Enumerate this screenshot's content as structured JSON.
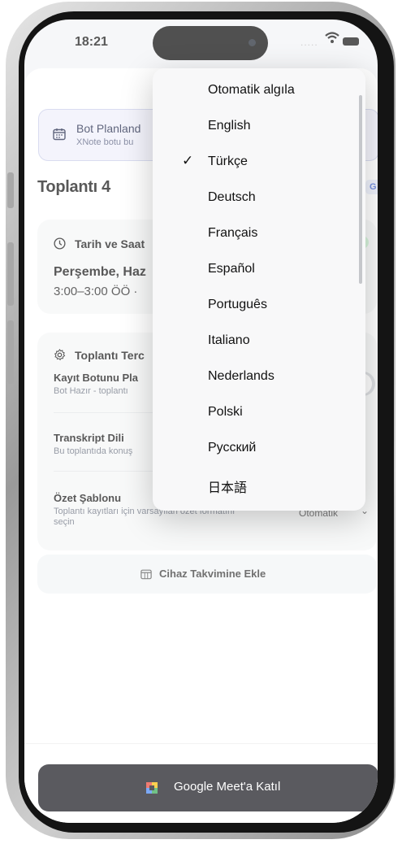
{
  "status_bar": {
    "time": "18:21"
  },
  "banner": {
    "title": "Bot Planland",
    "subtitle": "XNote botu bu"
  },
  "meeting": {
    "title": "Toplantı 4",
    "edit_icon_letter": "G"
  },
  "datetime_card": {
    "heading": "Tarih ve Saat",
    "date": "Perşembe, Haz",
    "time_range": "3:00–3:00 ÖÖ ·"
  },
  "preferences_card": {
    "heading": "Toplantı Terc",
    "bot_label": "Kayıt Botunu Pla",
    "bot_desc": "Bot Hazır - toplantı",
    "transcript_label": "Transkript Dili",
    "transcript_desc": "Bu toplantıda konuş",
    "summary_label": "Özet Şablonu",
    "summary_desc": "Toplantı kayıtları için varsayılan özet formatını seçin",
    "summary_value": "Otomatik"
  },
  "calendar_button": {
    "label": "Cihaz Takvimine Ekle"
  },
  "join_button": {
    "label": "Google Meet'a Katıl"
  },
  "language_menu": {
    "selected": "Türkçe",
    "items": [
      {
        "label": "Otomatik algıla",
        "check": ""
      },
      {
        "label": "English",
        "check": ""
      },
      {
        "label": "Türkçe",
        "check": "✓"
      },
      {
        "label": "Deutsch",
        "check": ""
      },
      {
        "label": "Français",
        "check": ""
      },
      {
        "label": "Español",
        "check": ""
      },
      {
        "label": "Português",
        "check": ""
      },
      {
        "label": "Italiano",
        "check": ""
      },
      {
        "label": "Nederlands",
        "check": ""
      },
      {
        "label": "Polski",
        "check": ""
      },
      {
        "label": "Русский",
        "check": ""
      },
      {
        "label": "日本語",
        "check": ""
      }
    ]
  },
  "colors": {
    "accent": "#3d62d6",
    "banner_bg": "#eff0fb",
    "join_bg": "#14141b"
  }
}
